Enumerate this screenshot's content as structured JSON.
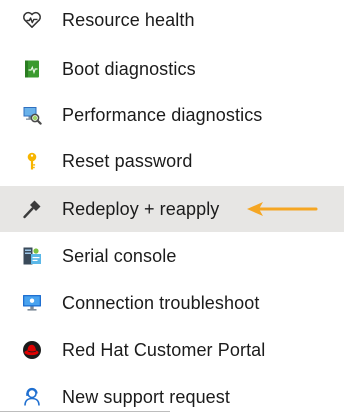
{
  "menu": {
    "items": [
      {
        "label": "Resource health",
        "icon": "heart-pulse-icon"
      },
      {
        "label": "Boot diagnostics",
        "icon": "boot-diagnostics-icon"
      },
      {
        "label": "Performance diagnostics",
        "icon": "performance-diagnostics-icon"
      },
      {
        "label": "Reset password",
        "icon": "key-icon"
      },
      {
        "label": "Redeploy + reapply",
        "icon": "hammer-icon",
        "selected": true
      },
      {
        "label": "Serial console",
        "icon": "serial-console-icon"
      },
      {
        "label": "Connection troubleshoot",
        "icon": "connection-troubleshoot-icon"
      },
      {
        "label": "Red Hat Customer Portal",
        "icon": "red-hat-icon"
      },
      {
        "label": "New support request",
        "icon": "support-person-icon"
      }
    ]
  },
  "colors": {
    "selected_bg": "#e7e6e4",
    "annotation_arrow": "#f5a623"
  }
}
